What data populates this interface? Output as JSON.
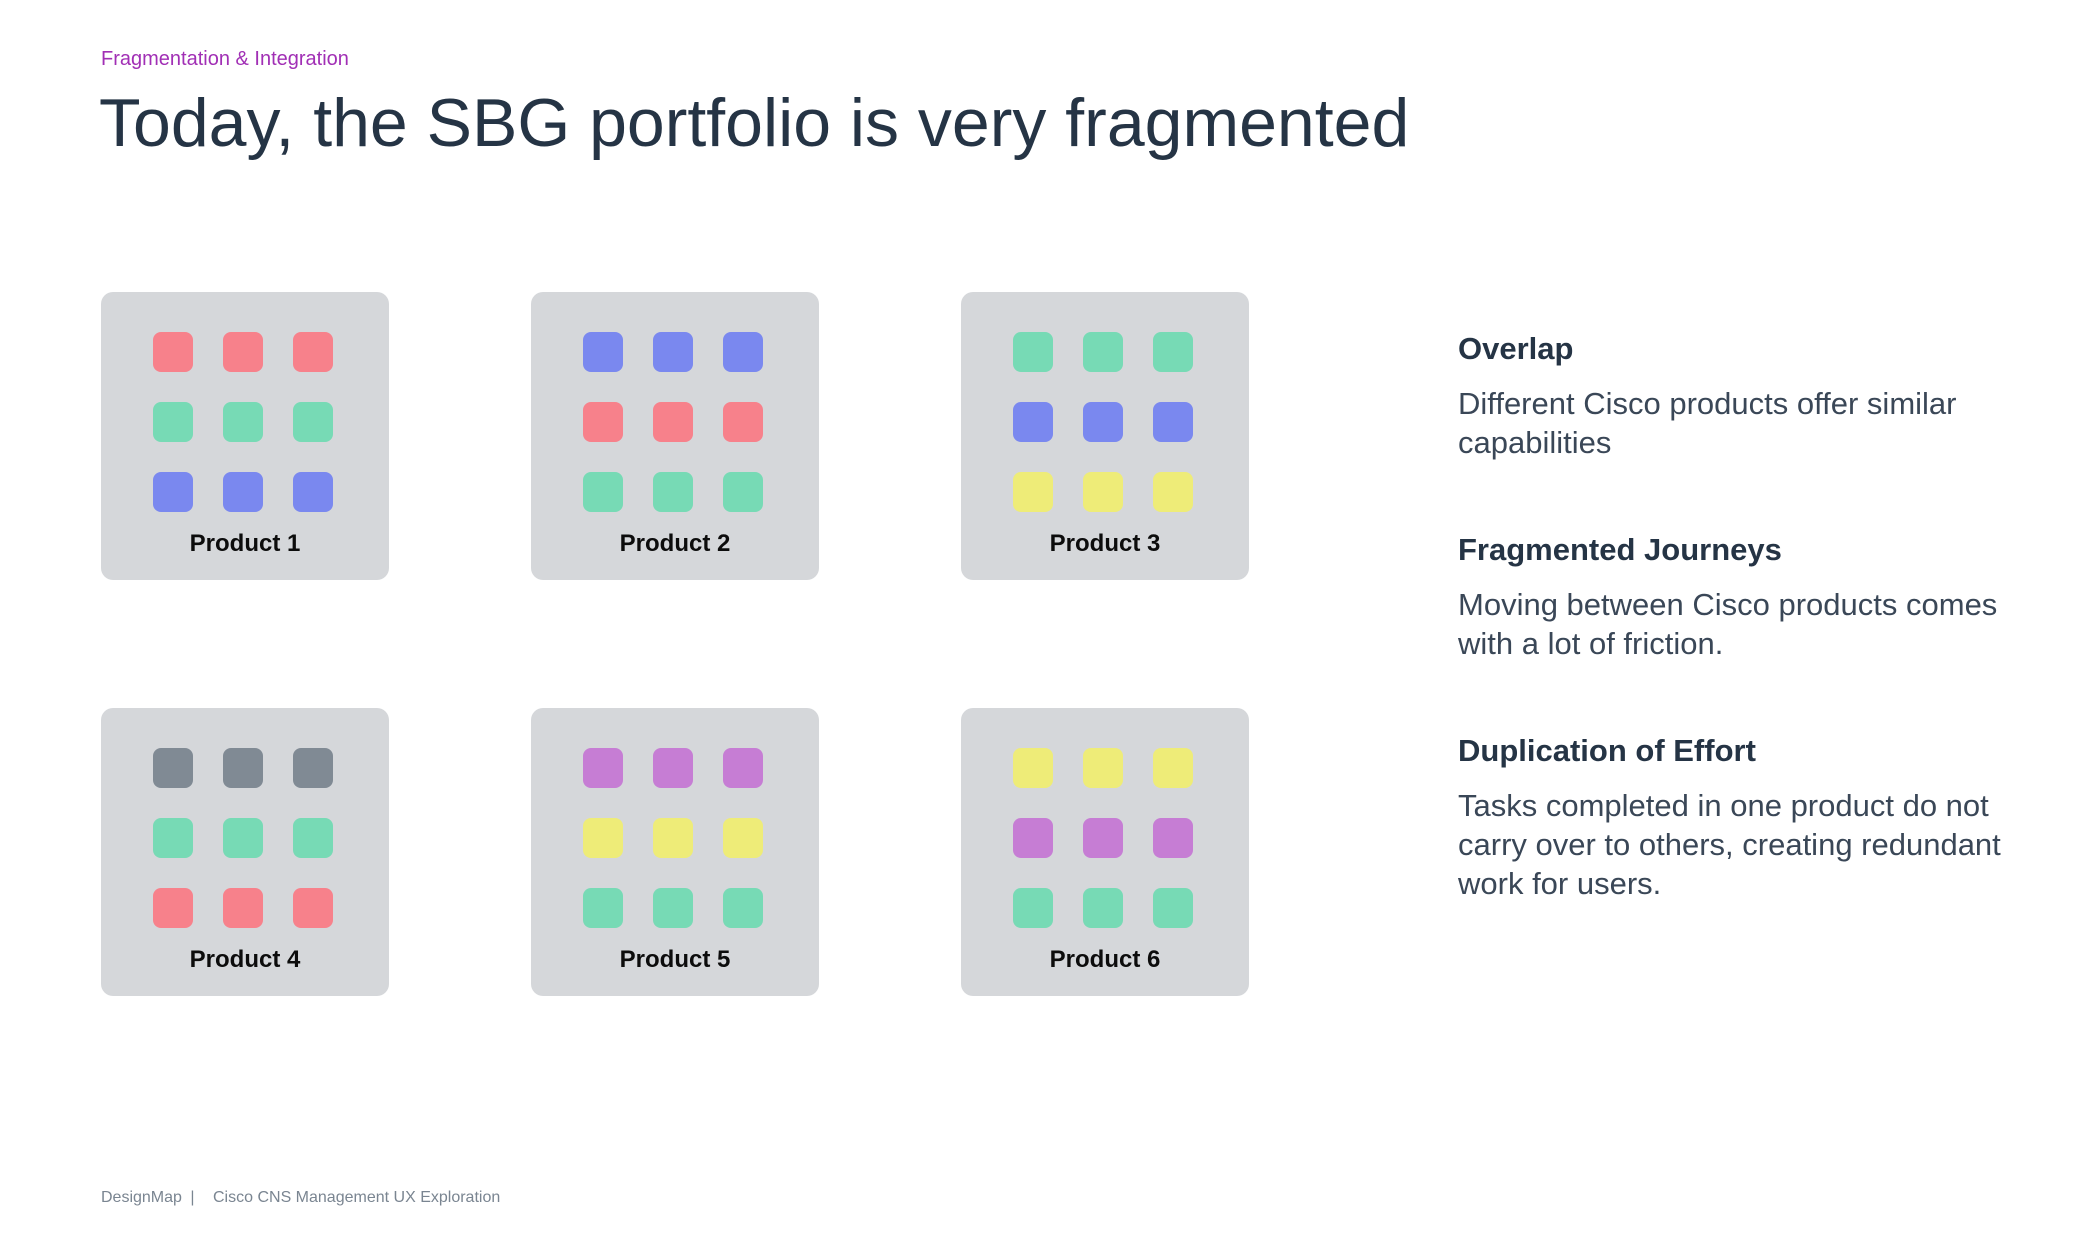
{
  "header": {
    "eyebrow": "Fragmentation & Integration",
    "title": "Today, the SBG portfolio is very fragmented"
  },
  "colors": {
    "red": "#f7818b",
    "green": "#77dab5",
    "blue": "#7a88ef",
    "yellow": "#eeec78",
    "gray": "#808a94",
    "purple": "#c67dd4",
    "card_bg": "#d5d7da"
  },
  "products": [
    {
      "label": "Product 1",
      "rows": [
        "red",
        "green",
        "blue"
      ]
    },
    {
      "label": "Product 2",
      "rows": [
        "blue",
        "red",
        "green"
      ]
    },
    {
      "label": "Product 3",
      "rows": [
        "green",
        "blue",
        "yellow"
      ]
    },
    {
      "label": "Product 4",
      "rows": [
        "gray",
        "green",
        "red"
      ]
    },
    {
      "label": "Product 5",
      "rows": [
        "purple",
        "yellow",
        "green"
      ]
    },
    {
      "label": "Product 6",
      "rows": [
        "yellow",
        "purple",
        "green"
      ]
    }
  ],
  "points": [
    {
      "heading": "Overlap",
      "body": "Different Cisco products offer similar capabilities"
    },
    {
      "heading": "Fragmented Journeys",
      "body": "Moving between Cisco products comes with a lot of friction."
    },
    {
      "heading": "Duplication of Effort",
      "body": "Tasks completed in one product do not carry over to others, creating redundant work for users."
    }
  ],
  "footer": {
    "brand": "DesignMap",
    "separator": "|",
    "project": "Cisco CNS Management UX Exploration"
  }
}
